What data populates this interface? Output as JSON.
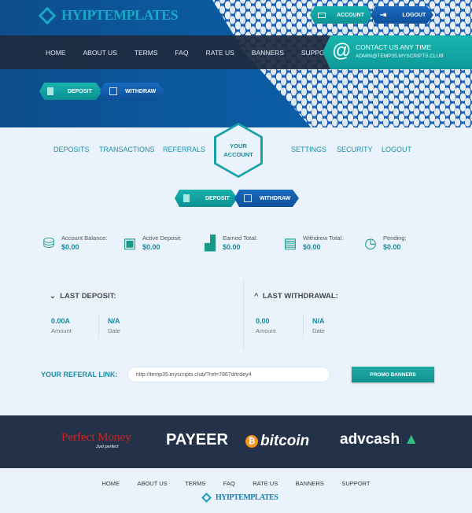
{
  "header": {
    "logo": "HYIPTEMPLATES",
    "account": "ACCOUNT",
    "logout": "LOGOUT",
    "deposit": "DEPOSIT",
    "withdraw": "WITHDRAW"
  },
  "nav": [
    "HOME",
    "ABOUT US",
    "TERMS",
    "FAQ",
    "RATE US",
    "BANNERS",
    "SUPPORT"
  ],
  "contact": {
    "title": "CONTACT US ANY TIME",
    "email": "ADMIN@TEMP35.MYSCRIPTS.CLUB"
  },
  "account_nav": {
    "left": [
      "DEPOSITS",
      "TRANSACTIONS",
      "REFERRALS"
    ],
    "center_line1": "YOUR",
    "center_line2": "ACCOUNT",
    "right": [
      "SETTINGS",
      "SECURITY",
      "LOGOUT"
    ]
  },
  "actions": {
    "deposit": "DEPOSIT",
    "withdraw": "WITHDRAW"
  },
  "stats": [
    {
      "label": "Account Balance:",
      "value": "$0.00",
      "icon": "coins-icon"
    },
    {
      "label": "Active Deposit:",
      "value": "$0.00",
      "icon": "safe-icon"
    },
    {
      "label": "Earned Total:",
      "value": "$0.00",
      "icon": "growth-chart-icon"
    },
    {
      "label": "Withdrew Total:",
      "value": "$0.00",
      "icon": "atm-icon"
    },
    {
      "label": "Pending:",
      "value": "$0.00",
      "icon": "clock-dollar-icon"
    }
  ],
  "last_deposit": {
    "title": "LAST DEPOSIT:",
    "amount": "0.00A",
    "amount_label": "Amount",
    "date": "N/A",
    "date_label": "Date"
  },
  "last_withdrawal": {
    "title": "LAST WITHDRAWAL:",
    "amount": "0.00",
    "amount_label": "Amount",
    "date": "N/A",
    "date_label": "Date"
  },
  "referral": {
    "label": "YOUR REFERAL LINK:",
    "value": "http://temp35.myscripts.club/?ref=7867drtrdey4",
    "button": "PROMO BANNERS"
  },
  "payments": {
    "pm": "Perfect Money",
    "pm_sub": "Just perfect",
    "payeer": "PAYEER",
    "bitcoin": "bitcoin",
    "advcash": "advcash"
  },
  "footer_nav": [
    "HOME",
    "ABOUT US",
    "TERMS",
    "FAQ",
    "RATE US",
    "BANNERS",
    "SUPPORT"
  ],
  "footer_logo": "HYIPTEMPLATES"
}
